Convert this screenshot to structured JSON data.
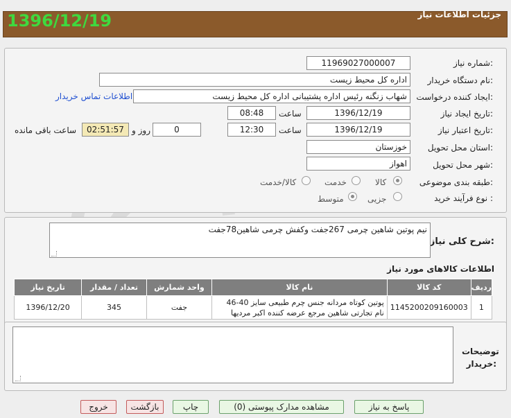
{
  "header": {
    "date": "1396/12/19",
    "title": "جزئیات اطلاعات نیاز"
  },
  "form": {
    "need_number_label": "شماره نیاز:",
    "need_number": "11969027000007",
    "buyer_org_label": "نام دستگاه خریدار:",
    "buyer_org": "اداره کل محیط زیست",
    "requester_label": "ایجاد کننده درخواست:",
    "requester": "شهاب زنگنه رئیس اداره پشتیبانی اداره کل محیط زیست",
    "contact_link": "اطلاعات تماس خریدار",
    "created_label": "تاریخ ایجاد نیاز:",
    "created_date": "1396/12/19",
    "time_label": "ساعت",
    "created_time": "08:48",
    "validity_label": "تاریخ اعتبار نیاز:",
    "validity_date": "1396/12/19",
    "validity_time": "12:30",
    "days_value": "0",
    "days_label": "روز و",
    "remaining_time": "02:51:57",
    "remaining_label": "ساعت باقی مانده",
    "province_label": "استان محل تحویل:",
    "province": "خوزستان",
    "city_label": "شهر محل تحویل:",
    "city": "اهواز",
    "category_label": "طبقه بندی موضوعی:",
    "category_options": [
      "کالا",
      "خدمت",
      "کالا/خدمت"
    ],
    "process_label": "نوع فرآیند خرید :",
    "process_options": [
      "متوسط",
      "جزیی"
    ]
  },
  "description": {
    "label": "شرح کلی نیاز:",
    "text": "نیم پوتین شاهین چرمی 267جفت وکفش چرمی شاهین78جفت"
  },
  "items": {
    "section_title": "اطلاعات کالاهای مورد نیاز",
    "columns": [
      "ردیف",
      "کد کالا",
      "نام کالا",
      "واحد شمارش",
      "تعداد / مقدار",
      "تاریخ نیاز"
    ],
    "rows": [
      [
        "1",
        "1145200209160003",
        "پوتین کوتاه مردانه جنس چرم طبیعی سایز 40-46 نام تجارتی شاهین مرجع عرضه کننده اکبر مردیها",
        "جفت",
        "345",
        "1396/12/20"
      ]
    ]
  },
  "buyer_notes": {
    "label": "توضیحات خریدار:",
    "text": ""
  },
  "buttons": {
    "reply": "پاسخ به نیاز",
    "attachments": "مشاهده مدارک پیوستی (0)",
    "print": "چاپ",
    "back": "بازگشت",
    "exit": "خروج"
  },
  "colors": {
    "header_bg": "#8b5a2b",
    "header_date": "#3fd93f",
    "table_header": "#7f7f7f",
    "timer_bg": "#f4e9b5"
  }
}
